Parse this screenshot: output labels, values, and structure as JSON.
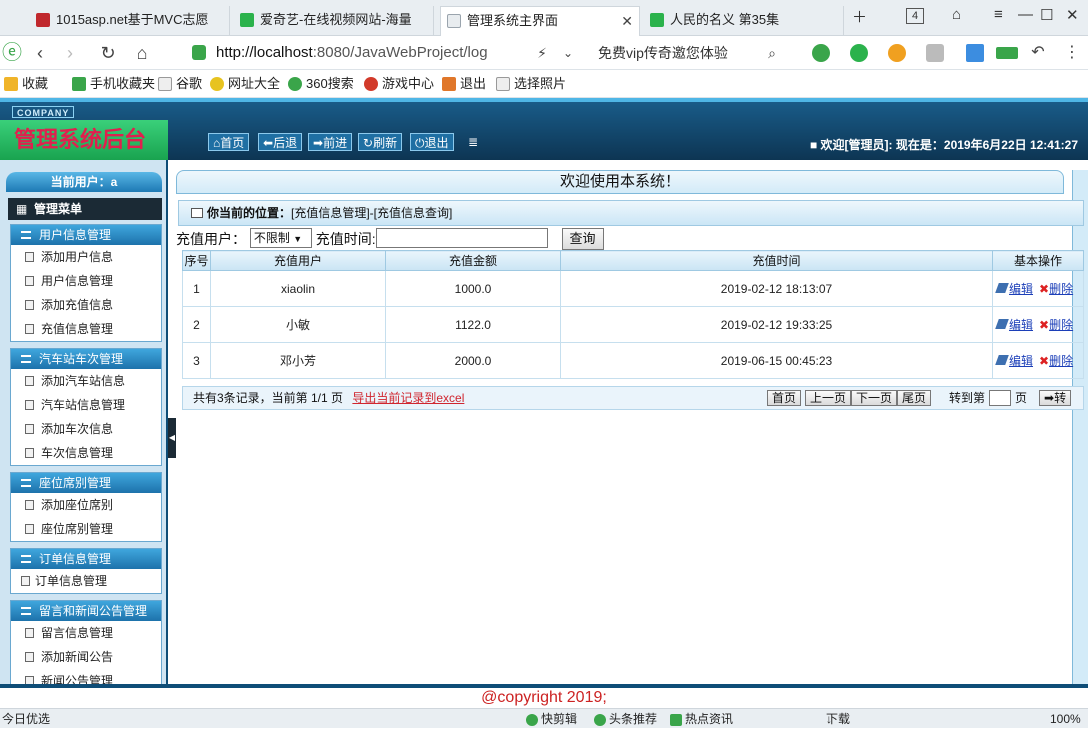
{
  "browser": {
    "tabs": [
      {
        "label": "1015asp.net基于MVC志愿",
        "fav": "#c0282d"
      },
      {
        "label": "爱奇艺-在线视频网站-海量",
        "fav": "#2bb24c"
      },
      {
        "label": "管理系统主界面",
        "fav": "#9aa4ad"
      },
      {
        "label": "人民的名义 第35集",
        "fav": "#2bb24c"
      }
    ],
    "tab_count": "4",
    "url_host": "http://localhost",
    "url_rest": ":8080/JavaWebProject/log",
    "promo": "免费vip传奇邀您体验",
    "bookmarks": [
      "收藏",
      "手机收藏夹",
      "谷歌",
      "网址大全",
      "360搜索",
      "游戏中心",
      "退出",
      "选择照片"
    ]
  },
  "app": {
    "company": "COMPANY",
    "title": "管理系统后台",
    "nav": [
      "首页",
      "后退",
      "前进",
      "刷新",
      "退出"
    ],
    "welcome_user": "欢迎[管理员]:",
    "now_label": "现在是：",
    "now_time": "2019年6月22日 12:41:27"
  },
  "sidebar": {
    "current_user": "当前用户：a",
    "menu_title": "管理菜单",
    "groups": [
      {
        "title": "用户信息管理",
        "items": [
          "添加用户信息",
          "用户信息管理",
          "添加充值信息",
          "充值信息管理"
        ]
      },
      {
        "title": "汽车站车次管理",
        "items": [
          "添加汽车站信息",
          "汽车站信息管理",
          "添加车次信息",
          "车次信息管理"
        ]
      },
      {
        "title": "座位席别管理",
        "items": [
          "添加座位席别",
          "座位席别管理"
        ]
      },
      {
        "title": "订单信息管理",
        "items": [
          "订单信息管理"
        ]
      },
      {
        "title": "留言和新闻公告管理",
        "items": [
          "留言信息管理",
          "添加新闻公告",
          "新闻公告管理"
        ]
      }
    ]
  },
  "main": {
    "welcome": "欢迎使用本系统！",
    "position_label": "你当前的位置：",
    "position_path": "[充值信息管理]-[充值信息查询]",
    "search": {
      "user_label": "充值用户：",
      "user_select": "不限制",
      "time_label": "充值时间:",
      "time_value": "",
      "query_button": "查询"
    },
    "table": {
      "headers": [
        "序号",
        "充值用户",
        "充值金额",
        "充值时间",
        "基本操作"
      ],
      "rows": [
        {
          "no": "1",
          "user": "xiaolin",
          "amount": "1000.0",
          "time": "2019-02-12 18:13:07"
        },
        {
          "no": "2",
          "user": "小敏",
          "amount": "1122.0",
          "time": "2019-02-12 19:33:25"
        },
        {
          "no": "3",
          "user": "邓小芳",
          "amount": "2000.0",
          "time": "2019-06-15 00:45:23"
        }
      ],
      "edit_label": "编辑",
      "delete_label": "删除"
    },
    "pager": {
      "summary": "共有3条记录，当前第 1/1 页",
      "export": "导出当前记录到excel",
      "first": "首页",
      "prev": "上一页",
      "next": "下一页",
      "last": "尾页",
      "goto_label": "转到第",
      "page_unit": "页",
      "go": "转"
    }
  },
  "footer": "@copyright 2019;",
  "status": {
    "left": "今日优选",
    "items": [
      "快剪辑",
      "头条推荐",
      "热点资讯",
      "下载"
    ],
    "zoom": "100%"
  }
}
